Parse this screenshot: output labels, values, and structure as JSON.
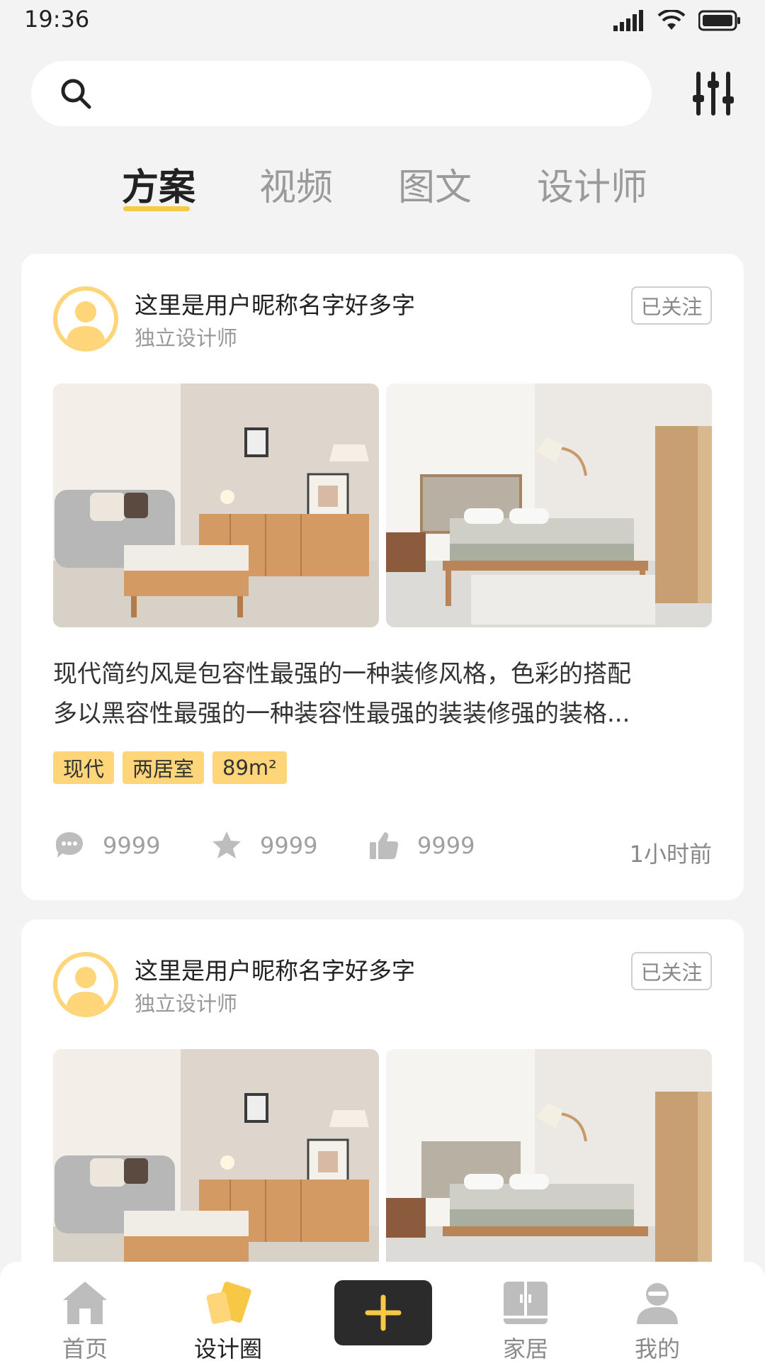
{
  "status_bar": {
    "time": "19:36"
  },
  "search": {
    "placeholder": ""
  },
  "tabs": [
    {
      "label": "方案",
      "active": true
    },
    {
      "label": "视频",
      "active": false
    },
    {
      "label": "图文",
      "active": false
    },
    {
      "label": "设计师",
      "active": false
    }
  ],
  "cards": [
    {
      "user_name": "这里是用户昵称名字好多字",
      "user_role": "独立设计师",
      "follow_label": "已关注",
      "description_line1": "现代简约风是包容性最强的一种装修风格，色彩的搭配",
      "description_line2": "多以黑容性最强的一种装容性最强的装装修强的装格...",
      "tags": [
        "现代",
        "两居室",
        "89m²"
      ],
      "comments": "9999",
      "favorites": "9999",
      "likes": "9999",
      "time_ago": "1小时前"
    },
    {
      "user_name": "这里是用户昵称名字好多字",
      "user_role": "独立设计师",
      "follow_label": "已关注"
    }
  ],
  "bottom_nav": {
    "home": "首页",
    "design_circle": "设计圈",
    "furniture": "家居",
    "mine": "我的"
  },
  "colors": {
    "accent": "#f7c845",
    "tag_bg": "#ffd57a",
    "dark_button": "#2b2b2b",
    "background": "#f3f3f3"
  }
}
